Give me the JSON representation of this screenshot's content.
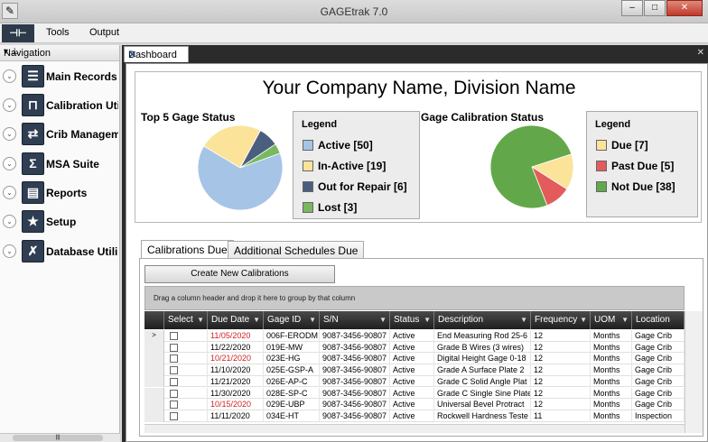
{
  "window": {
    "title": "GAGEtrak 7.0"
  },
  "menu": {
    "items": [
      "Tools",
      "Output"
    ]
  },
  "navigation": {
    "title": "Navigation",
    "items": [
      {
        "label": "Main Records",
        "icon": "records-icon"
      },
      {
        "label": "Calibration Uti",
        "icon": "calibration-icon"
      },
      {
        "label": "Crib Managem",
        "icon": "crib-icon"
      },
      {
        "label": "MSA Suite",
        "icon": "sigma-icon"
      },
      {
        "label": "Reports",
        "icon": "printer-icon"
      },
      {
        "label": "Setup",
        "icon": "star-icon"
      },
      {
        "label": "Database Utili",
        "icon": "wrench-icon"
      }
    ]
  },
  "dashboard": {
    "tab_label": "Dashboard",
    "company_name": "Your Company Name, Division Name",
    "status_chart": {
      "title": "Top 5 Gage Status",
      "legend_title": "Legend",
      "legend": [
        {
          "label": "Active [50]",
          "color": "#a6c4e6"
        },
        {
          "label": "In-Active [19]",
          "color": "#fbe39a"
        },
        {
          "label": "Out for Repair [6]",
          "color": "#4a5f7e"
        },
        {
          "label": "Lost [3]",
          "color": "#78b860"
        }
      ]
    },
    "calibration_chart": {
      "title": "Gage Calibration Status",
      "legend_title": "Legend",
      "legend": [
        {
          "label": "Due [7]",
          "color": "#fbe39a"
        },
        {
          "label": "Past Due [5]",
          "color": "#e35b5b"
        },
        {
          "label": "Not Due [38]",
          "color": "#62a84a"
        }
      ]
    }
  },
  "chart_data": [
    {
      "type": "pie",
      "title": "Top 5 Gage Status",
      "categories": [
        "Active",
        "In-Active",
        "Out for Repair",
        "Lost"
      ],
      "values": [
        50,
        19,
        6,
        3
      ],
      "colors": [
        "#a6c4e6",
        "#fbe39a",
        "#4a5f7e",
        "#78b860"
      ]
    },
    {
      "type": "pie",
      "title": "Gage Calibration Status",
      "categories": [
        "Due",
        "Past Due",
        "Not Due"
      ],
      "values": [
        7,
        5,
        38
      ],
      "colors": [
        "#fbe39a",
        "#e35b5b",
        "#62a84a"
      ]
    }
  ],
  "tabs": [
    "Calibrations Due",
    "Additional Schedules Due"
  ],
  "create_button": "Create New Calibrations",
  "group_hint": "Drag a column header and drop it here to group by that column",
  "grid": {
    "columns": [
      "Select",
      "Due Date",
      "Gage ID",
      "S/N",
      "Status",
      "Description",
      "Frequency",
      "UOM",
      "Location"
    ],
    "rows": [
      {
        "due": "11/05/2020",
        "overdue": true,
        "gage": "006F-ERODM",
        "sn": "9087-3456-90807",
        "status": "Active",
        "desc": "End Measuring Rod 25-6",
        "freq": "12",
        "uom": "Months",
        "loc": "Gage Crib"
      },
      {
        "due": "11/22/2020",
        "overdue": false,
        "gage": "019E-MW",
        "sn": "9087-3456-90807",
        "status": "Active",
        "desc": "Grade B Wires (3 wires)",
        "freq": "12",
        "uom": "Months",
        "loc": "Gage Crib"
      },
      {
        "due": "10/21/2020",
        "overdue": true,
        "gage": "023E-HG",
        "sn": "9087-3456-90807",
        "status": "Active",
        "desc": "Digital Height Gage 0-18",
        "freq": "12",
        "uom": "Months",
        "loc": "Gage Crib"
      },
      {
        "due": "11/10/2020",
        "overdue": false,
        "gage": "025E-GSP-A",
        "sn": "9087-3456-90807",
        "status": "Active",
        "desc": "Grade A Surface Plate 2",
        "freq": "12",
        "uom": "Months",
        "loc": "Gage Crib"
      },
      {
        "due": "11/21/2020",
        "overdue": false,
        "gage": "026E-AP-C",
        "sn": "9087-3456-90807",
        "status": "Active",
        "desc": "Grade C Solid Angle Plat",
        "freq": "12",
        "uom": "Months",
        "loc": "Gage Crib"
      },
      {
        "due": "11/30/2020",
        "overdue": false,
        "gage": "028E-SP-C",
        "sn": "9087-3456-90807",
        "status": "Active",
        "desc": "Grade C Single Sine Plate",
        "freq": "12",
        "uom": "Months",
        "loc": "Gage Crib"
      },
      {
        "due": "10/15/2020",
        "overdue": true,
        "gage": "029E-UBP",
        "sn": "9087-3456-90807",
        "status": "Active",
        "desc": "Universal Bevel Protract",
        "freq": "12",
        "uom": "Months",
        "loc": "Gage Crib"
      },
      {
        "due": "11/11/2020",
        "overdue": false,
        "gage": "034E-HT",
        "sn": "9087-3456-90807",
        "status": "Active",
        "desc": "Rockwell Hardness Teste",
        "freq": "11",
        "uom": "Months",
        "loc": "Inspection"
      }
    ]
  }
}
